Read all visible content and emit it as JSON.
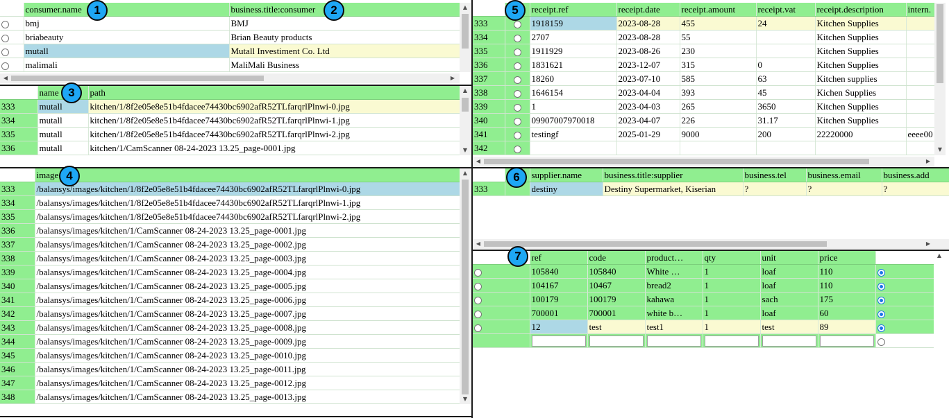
{
  "badges": [
    "1",
    "2",
    "3",
    "4",
    "5",
    "6",
    "7"
  ],
  "scroll_arrows": {
    "up": "▲",
    "down": "▼",
    "left": "◀",
    "right": "▶"
  },
  "consumer": {
    "headers": [
      "consumer.name",
      "business.title:consumer"
    ],
    "rows": [
      {
        "name": "bmj",
        "title": "BMJ"
      },
      {
        "name": "briabeauty",
        "title": "Brian Beauty products"
      },
      {
        "name": "mutall",
        "title": "Mutall Investiment Co. Ltd"
      },
      {
        "name": "malimali",
        "title": "MaliMali Business"
      }
    ]
  },
  "image_path": {
    "headers": [
      "name",
      "path"
    ],
    "rows": [
      {
        "num": "333",
        "name": "mutall",
        "path": "kitchen/1/8f2e05e8e51b4fdacee74430bc6902afR52TLfarqrlPlnwi-0.jpg"
      },
      {
        "num": "334",
        "name": "mutall",
        "path": "kitchen/1/8f2e05e8e51b4fdacee74430bc6902afR52TLfarqrlPlnwi-1.jpg"
      },
      {
        "num": "335",
        "name": "mutall",
        "path": "kitchen/1/8f2e05e8e51b4fdacee74430bc6902afR52TLfarqrlPlnwi-2.jpg"
      },
      {
        "num": "336",
        "name": "mutall",
        "path": "kitchen/1/CamScanner 08-24-2023 13.25_page-0001.jpg"
      }
    ]
  },
  "images": {
    "header": "image",
    "rows": [
      {
        "num": "333",
        "path": "/balansys/images/kitchen/1/8f2e05e8e51b4fdacee74430bc6902afR52TLfarqrlPlnwi-0.jpg"
      },
      {
        "num": "334",
        "path": "/balansys/images/kitchen/1/8f2e05e8e51b4fdacee74430bc6902afR52TLfarqrlPlnwi-1.jpg"
      },
      {
        "num": "335",
        "path": "/balansys/images/kitchen/1/8f2e05e8e51b4fdacee74430bc6902afR52TLfarqrlPlnwi-2.jpg"
      },
      {
        "num": "336",
        "path": "/balansys/images/kitchen/1/CamScanner 08-24-2023 13.25_page-0001.jpg"
      },
      {
        "num": "337",
        "path": "/balansys/images/kitchen/1/CamScanner 08-24-2023 13.25_page-0002.jpg"
      },
      {
        "num": "338",
        "path": "/balansys/images/kitchen/1/CamScanner 08-24-2023 13.25_page-0003.jpg"
      },
      {
        "num": "339",
        "path": "/balansys/images/kitchen/1/CamScanner 08-24-2023 13.25_page-0004.jpg"
      },
      {
        "num": "340",
        "path": "/balansys/images/kitchen/1/CamScanner 08-24-2023 13.25_page-0005.jpg"
      },
      {
        "num": "341",
        "path": "/balansys/images/kitchen/1/CamScanner 08-24-2023 13.25_page-0006.jpg"
      },
      {
        "num": "342",
        "path": "/balansys/images/kitchen/1/CamScanner 08-24-2023 13.25_page-0007.jpg"
      },
      {
        "num": "343",
        "path": "/balansys/images/kitchen/1/CamScanner 08-24-2023 13.25_page-0008.jpg"
      },
      {
        "num": "344",
        "path": "/balansys/images/kitchen/1/CamScanner 08-24-2023 13.25_page-0009.jpg"
      },
      {
        "num": "345",
        "path": "/balansys/images/kitchen/1/CamScanner 08-24-2023 13.25_page-0010.jpg"
      },
      {
        "num": "346",
        "path": "/balansys/images/kitchen/1/CamScanner 08-24-2023 13.25_page-0011.jpg"
      },
      {
        "num": "347",
        "path": "/balansys/images/kitchen/1/CamScanner 08-24-2023 13.25_page-0012.jpg"
      },
      {
        "num": "348",
        "path": "/balansys/images/kitchen/1/CamScanner 08-24-2023 13.25_page-0013.jpg"
      }
    ]
  },
  "receipts": {
    "headers": [
      "receipt.ref",
      "receipt.date",
      "receipt.amount",
      "receipt.vat",
      "receipt.description",
      "intern."
    ],
    "rows": [
      {
        "num": "333",
        "ref": "1918159",
        "date": "2023-08-28",
        "amount": "455",
        "vat": "24",
        "description": "Kitchen Supplies",
        "intern": ""
      },
      {
        "num": "334",
        "ref": "2707",
        "date": "2023-08-28",
        "amount": "55",
        "vat": "",
        "description": "Kitchen Supplies",
        "intern": ""
      },
      {
        "num": "335",
        "ref": "1911929",
        "date": "2023-08-26",
        "amount": "230",
        "vat": "",
        "description": "Kitchen Supplies",
        "intern": ""
      },
      {
        "num": "336",
        "ref": "1831621",
        "date": "2023-12-07",
        "amount": "315",
        "vat": "0",
        "description": "Kitchen Supplies",
        "intern": ""
      },
      {
        "num": "337",
        "ref": "18260",
        "date": "2023-07-10",
        "amount": "585",
        "vat": "63",
        "description": "Kitchen supplies",
        "intern": ""
      },
      {
        "num": "338",
        "ref": "1646154",
        "date": "2023-04-04",
        "amount": "393",
        "vat": "45",
        "description": "Kichen Supplies",
        "intern": ""
      },
      {
        "num": "339",
        "ref": "1",
        "date": "2023-04-03",
        "amount": "265",
        "vat": "3650",
        "description": "Kitchen Supplies",
        "intern": ""
      },
      {
        "num": "340",
        "ref": "09907007970018",
        "date": "2023-04-07",
        "amount": "226",
        "vat": "31.17",
        "description": "Kitchen Supplies",
        "intern": ""
      },
      {
        "num": "341",
        "ref": "testingf",
        "date": "2025-01-29",
        "amount": "9000",
        "vat": "200",
        "description": "22220000",
        "intern": "eeee00"
      },
      {
        "num": "342",
        "ref": "",
        "date": "",
        "amount": "",
        "vat": "",
        "description": "",
        "intern": ""
      }
    ]
  },
  "supplier": {
    "headers": [
      "supplier.name",
      "business.title:supplier",
      "business.tel",
      "business.email",
      "business.add"
    ],
    "rows": [
      {
        "num": "333",
        "name": "destiny",
        "title": "Destiny Supermarket, Kiserian",
        "tel": "?",
        "email": "?",
        "add": "?"
      }
    ]
  },
  "items": {
    "headers": [
      "ref",
      "code",
      "product…",
      "qty",
      "unit",
      "price"
    ],
    "rows": [
      {
        "ref": "105840",
        "code": "105840",
        "product": "White …",
        "qty": "1",
        "unit": "loaf",
        "price": "110",
        "selected": true
      },
      {
        "ref": "104167",
        "code": "10467",
        "product": "bread2",
        "qty": "1",
        "unit": "loaf",
        "price": "110",
        "selected": true
      },
      {
        "ref": "100179",
        "code": "100179",
        "product": "kahawa",
        "qty": "1",
        "unit": "sach",
        "price": "175",
        "selected": true
      },
      {
        "ref": "700001",
        "code": "700001",
        "product": "white b…",
        "qty": "1",
        "unit": "loaf",
        "price": "60",
        "selected": true
      },
      {
        "ref": "12",
        "code": "test",
        "product": "test1",
        "qty": "1",
        "unit": "test",
        "price": "89",
        "selected": true
      }
    ]
  }
}
